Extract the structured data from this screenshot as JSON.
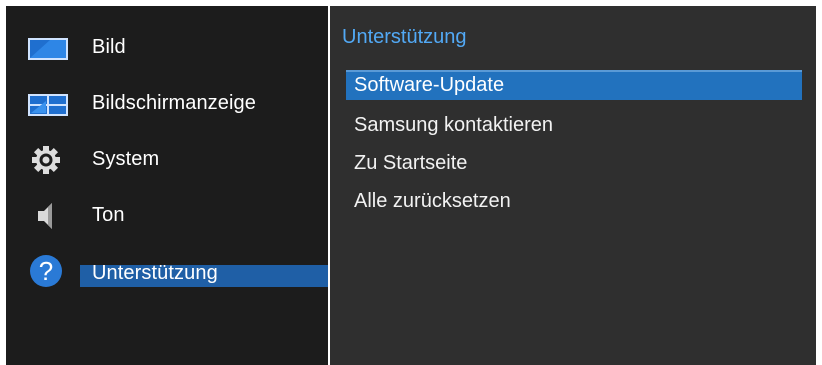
{
  "colors": {
    "left_panel_bg": "#1c1c1c",
    "right_panel_bg": "#2f2f2f",
    "accent_blue": "#2272be",
    "title_blue": "#52a9f5"
  },
  "left_menu": {
    "items": [
      {
        "label": "Bild",
        "icon": "picture-icon"
      },
      {
        "label": "Bildschirmanzeige",
        "icon": "onscreen-display-icon"
      },
      {
        "label": "System",
        "icon": "gear-icon"
      },
      {
        "label": "Ton",
        "icon": "speaker-icon"
      },
      {
        "label": "Unterstützung",
        "icon": "help-icon",
        "selected": true
      }
    ]
  },
  "right_panel": {
    "title": "Unterstützung",
    "items": [
      {
        "label": "Software-Update",
        "selected": true
      },
      {
        "label": "Samsung kontaktieren"
      },
      {
        "label": "Zu Startseite"
      },
      {
        "label": "Alle zurücksetzen"
      }
    ]
  }
}
